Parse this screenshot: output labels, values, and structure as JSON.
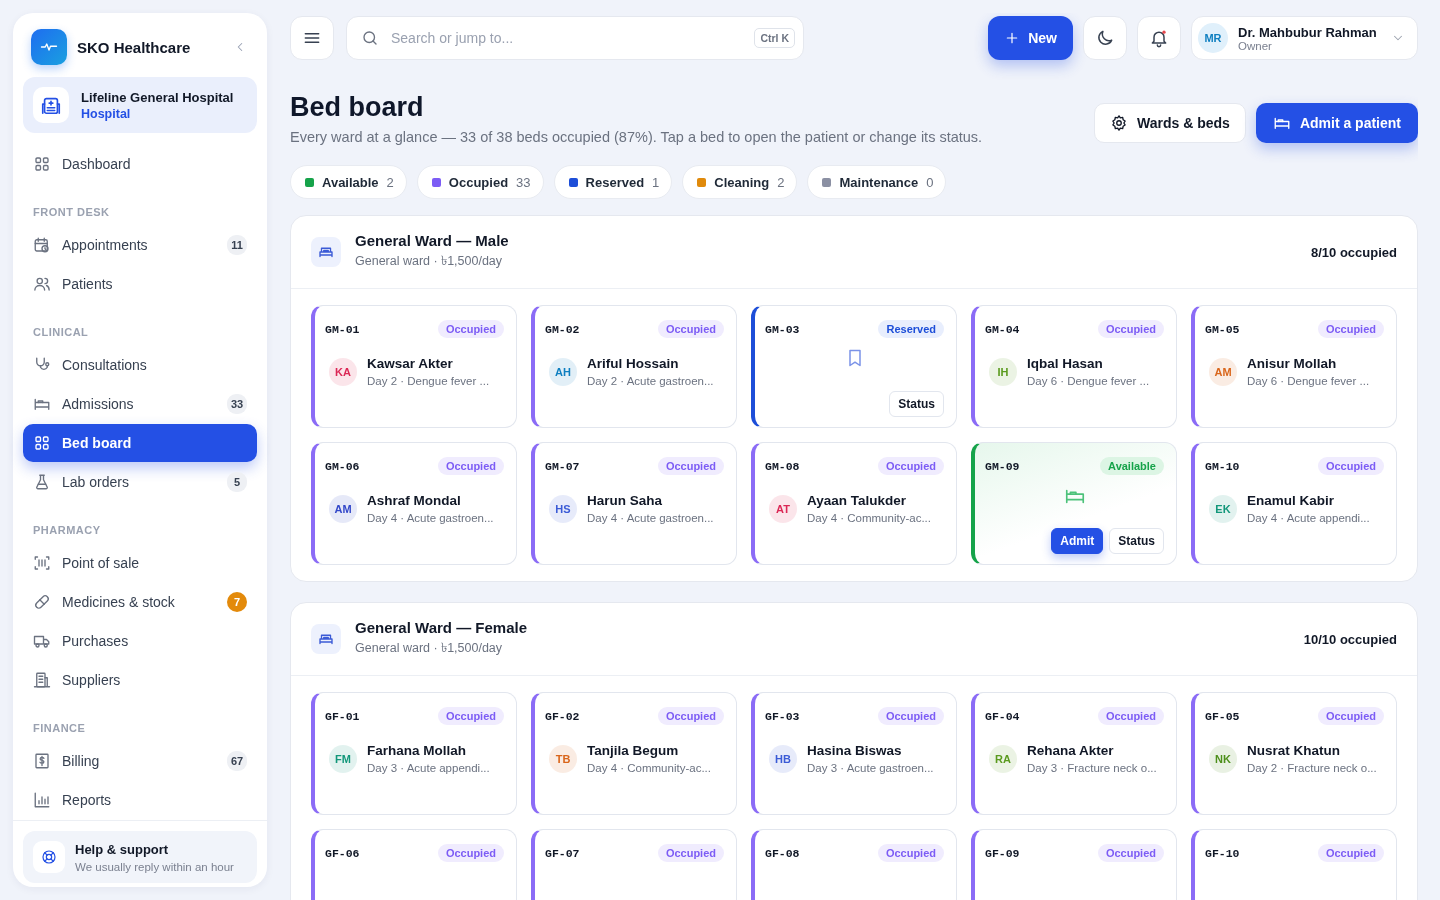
{
  "brand": {
    "name": "SKO Healthcare"
  },
  "org": {
    "name": "Lifeline General Hospital",
    "type": "Hospital"
  },
  "nav": [
    {
      "items": [
        {
          "label": "Dashboard",
          "selected": false
        }
      ]
    },
    {
      "heading": "FRONT DESK",
      "items": [
        {
          "label": "Appointments",
          "badge": "11",
          "selected": false
        },
        {
          "label": "Patients",
          "selected": false
        }
      ]
    },
    {
      "heading": "CLINICAL",
      "items": [
        {
          "label": "Consultations",
          "selected": false
        },
        {
          "label": "Admissions",
          "badge": "33",
          "selected": false
        },
        {
          "label": "Bed board",
          "selected": true
        },
        {
          "label": "Lab orders",
          "badge": "5",
          "selected": false
        }
      ]
    },
    {
      "heading": "PHARMACY",
      "items": [
        {
          "label": "Point of sale",
          "selected": false
        },
        {
          "label": "Medicines & stock",
          "badge": "7",
          "alert": true,
          "selected": false
        },
        {
          "label": "Purchases",
          "selected": false
        },
        {
          "label": "Suppliers",
          "selected": false
        }
      ]
    },
    {
      "heading": "FINANCE",
      "items": [
        {
          "label": "Billing",
          "badge": "67",
          "selected": false
        },
        {
          "label": "Reports",
          "selected": false
        }
      ]
    }
  ],
  "help": {
    "title": "Help & support",
    "subtitle": "We usually reply within an hour"
  },
  "topbar": {
    "search": {
      "placeholder": "Search or jump to...",
      "shortcut": "Ctrl K"
    },
    "new_button": "New",
    "notifications": {
      "unread": true
    },
    "user": {
      "initials": "MR",
      "name": "Dr. Mahbubur Rahman",
      "role": "Owner"
    }
  },
  "page": {
    "title": "Bed board",
    "subtitle": "Every ward at a glance — 33 of 38 beds occupied (87%). Tap a bed to open the patient or change its status.",
    "actions": [
      "Wards & beds",
      "Admit a patient"
    ]
  },
  "legend": [
    {
      "label": "Available",
      "count": "2",
      "color": "#16a34a"
    },
    {
      "label": "Occupied",
      "count": "33",
      "color": "#7c5cf5"
    },
    {
      "label": "Reserved",
      "count": "1",
      "color": "#1d4ed8"
    },
    {
      "label": "Cleaning",
      "count": "2",
      "color": "#e08a0b"
    },
    {
      "label": "Maintenance",
      "count": "0",
      "color": "#8b90a3"
    }
  ],
  "wards": [
    {
      "name": "General Ward — Male",
      "meta": "General ward · ৳1,500/day",
      "occupancy": "8/10 occupied",
      "beds": [
        {
          "id": "GM-01",
          "kind": "occupied",
          "status": "Occupied",
          "patient": {
            "initials": "KA",
            "name": "Kawsar Akter",
            "detail": "Day 2 · Dengue fever ...",
            "color": "#db2755"
          }
        },
        {
          "id": "GM-02",
          "kind": "occupied",
          "status": "Occupied",
          "patient": {
            "initials": "AH",
            "name": "Ariful Hossain",
            "detail": "Day 2 · Acute gastroen...",
            "color": "#0e7fc0"
          }
        },
        {
          "id": "GM-03",
          "kind": "reserved",
          "status": "Reserved",
          "buttons": [
            "Status"
          ]
        },
        {
          "id": "GM-04",
          "kind": "occupied",
          "status": "Occupied",
          "patient": {
            "initials": "IH",
            "name": "Iqbal Hasan",
            "detail": "Day 6 · Dengue fever ...",
            "color": "#5a9a1e"
          }
        },
        {
          "id": "GM-05",
          "kind": "occupied",
          "status": "Occupied",
          "patient": {
            "initials": "AM",
            "name": "Anisur Mollah",
            "detail": "Day 6 · Dengue fever ...",
            "color": "#d9651a"
          }
        },
        {
          "id": "GM-06",
          "kind": "occupied",
          "status": "Occupied",
          "patient": {
            "initials": "AM",
            "name": "Ashraf Mondal",
            "detail": "Day 4 · Acute gastroen...",
            "color": "#3348c9"
          }
        },
        {
          "id": "GM-07",
          "kind": "occupied",
          "status": "Occupied",
          "patient": {
            "initials": "HS",
            "name": "Harun Saha",
            "detail": "Day 4 · Acute gastroen...",
            "color": "#3b5bd6"
          }
        },
        {
          "id": "GM-08",
          "kind": "occupied",
          "status": "Occupied",
          "patient": {
            "initials": "AT",
            "name": "Ayaan Talukder",
            "detail": "Day 4 · Community-ac...",
            "color": "#db2755"
          }
        },
        {
          "id": "GM-09",
          "kind": "available",
          "status": "Available",
          "buttons": [
            "Admit",
            "Status"
          ]
        },
        {
          "id": "GM-10",
          "kind": "occupied",
          "status": "Occupied",
          "patient": {
            "initials": "EK",
            "name": "Enamul Kabir",
            "detail": "Day 4 · Acute appendi...",
            "color": "#12977a"
          }
        }
      ]
    },
    {
      "name": "General Ward — Female",
      "meta": "General ward · ৳1,500/day",
      "occupancy": "10/10 occupied",
      "beds": [
        {
          "id": "GF-01",
          "kind": "occupied",
          "status": "Occupied",
          "patient": {
            "initials": "FM",
            "name": "Farhana Mollah",
            "detail": "Day 3 · Acute appendi...",
            "color": "#12977a"
          }
        },
        {
          "id": "GF-02",
          "kind": "occupied",
          "status": "Occupied",
          "patient": {
            "initials": "TB",
            "name": "Tanjila Begum",
            "detail": "Day 4 · Community-ac...",
            "color": "#d9651a"
          }
        },
        {
          "id": "GF-03",
          "kind": "occupied",
          "status": "Occupied",
          "patient": {
            "initials": "HB",
            "name": "Hasina Biswas",
            "detail": "Day 3 · Acute gastroen...",
            "color": "#3b5bd6"
          }
        },
        {
          "id": "GF-04",
          "kind": "occupied",
          "status": "Occupied",
          "patient": {
            "initials": "RA",
            "name": "Rehana Akter",
            "detail": "Day 3 · Fracture neck o...",
            "color": "#5a9a1e"
          }
        },
        {
          "id": "GF-05",
          "kind": "occupied",
          "status": "Occupied",
          "patient": {
            "initials": "NK",
            "name": "Nusrat Khatun",
            "detail": "Day 2 · Fracture neck o...",
            "color": "#4d8f1a"
          }
        },
        {
          "id": "GF-06",
          "kind": "occupied",
          "status": "Occupied"
        },
        {
          "id": "GF-07",
          "kind": "occupied",
          "status": "Occupied"
        },
        {
          "id": "GF-08",
          "kind": "occupied",
          "status": "Occupied"
        },
        {
          "id": "GF-09",
          "kind": "occupied",
          "status": "Occupied"
        },
        {
          "id": "GF-10",
          "kind": "occupied",
          "status": "Occupied"
        }
      ]
    }
  ]
}
